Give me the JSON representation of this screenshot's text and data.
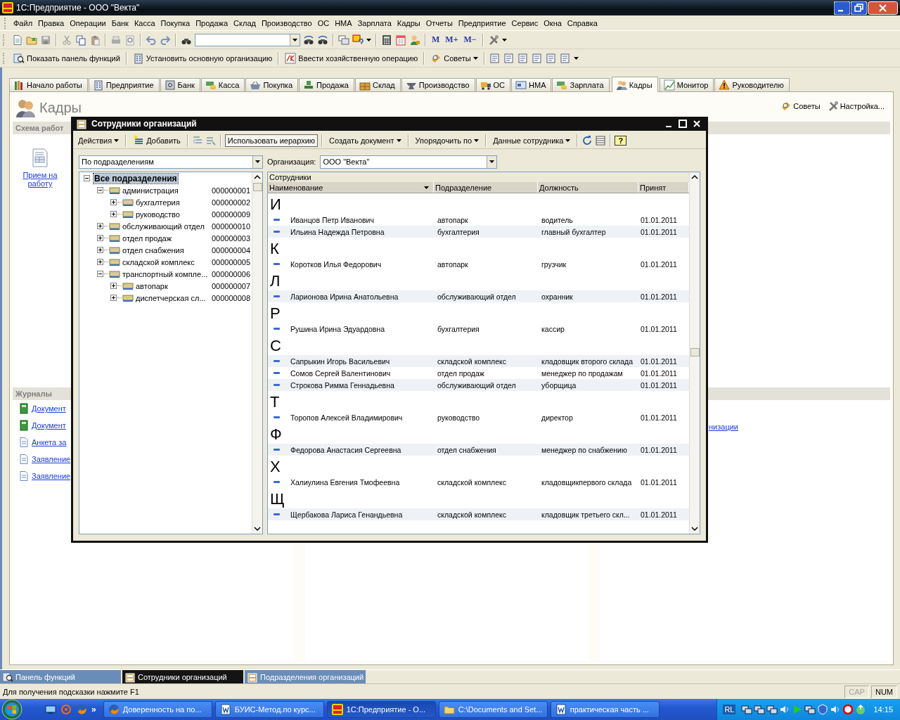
{
  "window": {
    "title": "1С:Предприятие - ООО \"Векта\""
  },
  "menu": [
    "Файл",
    "Правка",
    "Операции",
    "Банк",
    "Касса",
    "Покупка",
    "Продажа",
    "Склад",
    "Производство",
    "ОС",
    "НМА",
    "Зарплата",
    "Кадры",
    "Отчеты",
    "Предприятие",
    "Сервис",
    "Окна",
    "Справка"
  ],
  "toolbar": {
    "memory_buttons": [
      "M",
      "M+",
      "M−"
    ]
  },
  "function_bar": {
    "buttons": [
      "Показать панель функций",
      "Установить основную организацию",
      "Ввести хозяйственную операцию",
      "Советы"
    ]
  },
  "tabs": [
    {
      "label": "Начало работы",
      "selected": false
    },
    {
      "label": "Предприятие",
      "selected": false
    },
    {
      "label": "Банк",
      "selected": false
    },
    {
      "label": "Касса",
      "selected": false
    },
    {
      "label": "Покупка",
      "selected": false
    },
    {
      "label": "Продажа",
      "selected": false
    },
    {
      "label": "Склад",
      "selected": false
    },
    {
      "label": "Производство",
      "selected": false
    },
    {
      "label": "ОС",
      "selected": false
    },
    {
      "label": "НМА",
      "selected": false
    },
    {
      "label": "Зарплата",
      "selected": false
    },
    {
      "label": "Кадры",
      "selected": true
    },
    {
      "label": "Монитор",
      "selected": false
    },
    {
      "label": "Руководителю",
      "selected": false
    }
  ],
  "panel": {
    "title": "Кадры",
    "links": [
      "Советы",
      "Настройка..."
    ],
    "scheme": {
      "title": "Схема работ",
      "tiles": [
        "Прием на работу"
      ]
    },
    "journals": {
      "title": "Журналы",
      "links": [
        {
          "kind": "journal",
          "label": "Документ"
        },
        {
          "kind": "journal",
          "label": "Документ"
        },
        {
          "kind": "form",
          "label": "Анкета за"
        },
        {
          "kind": "form",
          "label": "Заявление"
        },
        {
          "kind": "form",
          "label": "Заявление"
        }
      ]
    },
    "right_links": [
      "низации"
    ]
  },
  "dialog": {
    "title": "Сотрудники организаций",
    "toolbar": [
      {
        "kind": "menu",
        "label": "Действия"
      },
      {
        "kind": "add",
        "label": "Добавить"
      },
      {
        "kind": "toggle",
        "label": "Использовать иерархию",
        "on": true
      },
      {
        "kind": "menu",
        "label": "Создать документ"
      },
      {
        "kind": "menu",
        "label": "Упорядочить по"
      },
      {
        "kind": "menu",
        "label": "Данные сотрудника"
      },
      {
        "kind": "help",
        "label": "?"
      }
    ],
    "filter": {
      "view": "По подразделениям",
      "org_label": "Организация:",
      "organization": "ООО \"Векта\""
    },
    "tree": {
      "name": "Все подразделения",
      "selected": true,
      "expanded": true,
      "children": [
        {
          "name": "администрация",
          "code": "000000001",
          "selected": false,
          "expanded": true,
          "children": [
            {
              "name": "бухгалтерия",
              "code": "000000002",
              "selected": false,
              "expanded": false
            },
            {
              "name": "руководство",
              "code": "000000009",
              "selected": false,
              "expanded": false
            }
          ]
        },
        {
          "name": "обслуживающий отдел",
          "code": "000000010",
          "selected": false,
          "expanded": false
        },
        {
          "name": "отдел продаж",
          "code": "000000003",
          "selected": false,
          "expanded": false
        },
        {
          "name": "отдел снабжения",
          "code": "000000004",
          "selected": false,
          "expanded": false
        },
        {
          "name": "складской комплекс",
          "code": "000000005",
          "selected": false,
          "expanded": false
        },
        {
          "name": "транспортный компле...",
          "code": "000000006",
          "selected": false,
          "expanded": true,
          "children": [
            {
              "name": "автопарк",
              "code": "000000007",
              "selected": false,
              "expanded": false
            },
            {
              "name": "диспетчерская сл...",
              "code": "000000008",
              "selected": false,
              "expanded": false
            }
          ]
        }
      ]
    },
    "table": {
      "caption": "Сотрудники",
      "columns": [
        "Наименование",
        "Подразделение",
        "Должность",
        "Принят"
      ],
      "groups": [
        {
          "letter": "И",
          "rows": [
            {
              "name": "Иванцов Петр Иванович",
              "department": "автопарк",
              "position": "водитель",
              "hired": "01.01.2011"
            },
            {
              "name": "Ильина Надежда Петровна",
              "department": "бухгалтерия",
              "position": "главный бухгалтер",
              "hired": "01.01.2011"
            }
          ]
        },
        {
          "letter": "К",
          "rows": [
            {
              "name": "Коротков  Илья Федорович",
              "department": "автопарк",
              "position": "грузчик",
              "hired": "01.01.2011"
            }
          ]
        },
        {
          "letter": "Л",
          "rows": [
            {
              "name": "Ларионова Ирина Анатольевна",
              "department": "обслуживающий отдел",
              "position": "охранник",
              "hired": "01.01.2011"
            }
          ]
        },
        {
          "letter": "Р",
          "rows": [
            {
              "name": "Рушина Ирина Эдуардовна",
              "department": "бухгалтерия",
              "position": "кассир",
              "hired": "01.01.2011"
            }
          ]
        },
        {
          "letter": "С",
          "rows": [
            {
              "name": "Сапрыкин Игорь Васильевич",
              "department": "складской комплекс",
              "position": "кладовщик второго склада",
              "hired": "01.01.2011"
            },
            {
              "name": "Сомов Сергей Валентинович",
              "department": "отдел продаж",
              "position": "менеджер по продажам",
              "hired": "01.01.2011"
            },
            {
              "name": "Строкова Римма Геннадьевна",
              "department": "обслуживающий отдел",
              "position": "уборщица",
              "hired": "01.01.2011"
            }
          ]
        },
        {
          "letter": "Т",
          "rows": [
            {
              "name": "Торопов Алексей Владимирович",
              "department": "руководство",
              "position": "директор",
              "hired": "01.01.2011"
            }
          ]
        },
        {
          "letter": "Ф",
          "rows": [
            {
              "name": "Федорова Анастасия Сергеевна",
              "department": "отдел снабжения",
              "position": "менеджер по снабжению",
              "hired": "01.01.2011"
            }
          ]
        },
        {
          "letter": "Х",
          "rows": [
            {
              "name": "Халиулина Евгения Тмофеевна",
              "department": "складской комплекс",
              "position": "кладовщикпервого склада",
              "hired": "01.01.2011"
            }
          ]
        },
        {
          "letter": "Щ",
          "rows": [
            {
              "name": "Щербакова Лариса Генандьевна",
              "department": "складской комплекс",
              "position": "кладовщик третьего скл...",
              "hired": "01.01.2011"
            }
          ]
        }
      ]
    }
  },
  "window_tabs": [
    {
      "label": "Панель функций",
      "selected": false
    },
    {
      "label": "Сотрудники организаций",
      "selected": true
    },
    {
      "label": "Подразделения организаций",
      "selected": false
    }
  ],
  "status_bar": {
    "hint": "Для получения подсказки нажмите F1",
    "indicators": [
      {
        "label": "CAP",
        "on": false
      },
      {
        "label": "NUM",
        "on": true
      }
    ]
  },
  "taskbar": {
    "more": "»",
    "tasks": [
      {
        "label": "Доверенность на по...",
        "kind": "browser",
        "selected": false
      },
      {
        "label": "БУИС-Метод.по курс...",
        "kind": "word",
        "selected": false
      },
      {
        "label": "1С:Предприятие - О...",
        "kind": "app",
        "selected": true
      },
      {
        "label": "C:\\Documents and Set...",
        "kind": "folder",
        "selected": false
      },
      {
        "label": "практическая часть ...",
        "kind": "word",
        "selected": false
      }
    ],
    "tray_label": "RL",
    "clock": "14:15"
  }
}
